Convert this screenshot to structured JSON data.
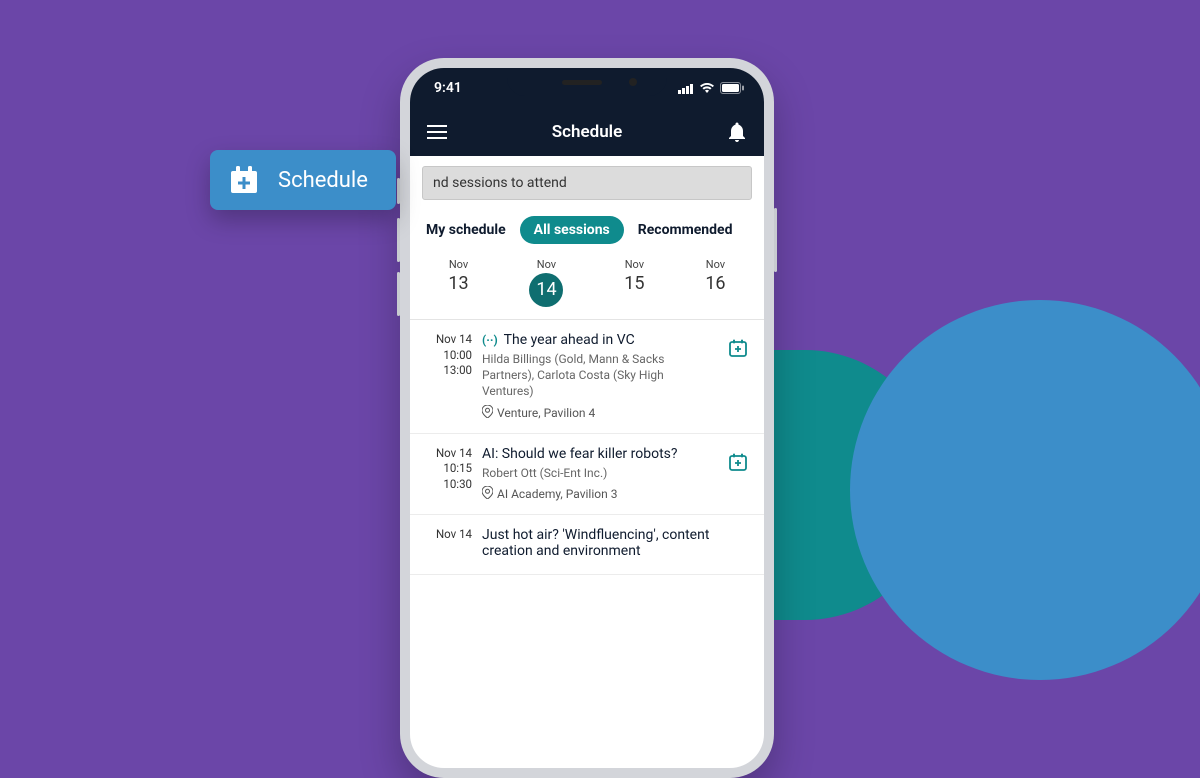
{
  "status": {
    "time": "9:41"
  },
  "header": {
    "title": "Schedule"
  },
  "search": {
    "placeholder": "Find sessions to attend",
    "visible_text": "nd sessions to attend"
  },
  "tabs": {
    "my": "My schedule",
    "all": "All sessions",
    "rec": "Recommended"
  },
  "dates": [
    {
      "month": "Nov",
      "day": "13",
      "active": false
    },
    {
      "month": "Nov",
      "day": "14",
      "active": true
    },
    {
      "month": "Nov",
      "day": "15",
      "active": false
    },
    {
      "month": "Nov",
      "day": "16",
      "active": false
    }
  ],
  "sessions": [
    {
      "date": "Nov 14",
      "start": "10:00",
      "end": "13:00",
      "live_badge": "(··)",
      "title": "The year ahead in VC",
      "speakers": "Hilda Billings (Gold, Mann & Sacks Partners), Carlota Costa (Sky High Ventures)",
      "location": "Venture, Pavilion 4"
    },
    {
      "date": "Nov 14",
      "start": "10:15",
      "end": "10:30",
      "title": "AI: Should we fear killer robots?",
      "speakers": "Robert Ott (Sci-Ent Inc.)",
      "location": "AI Academy, Pavilion 3"
    },
    {
      "date": "Nov 14",
      "title": "Just hot air? 'Windfluencing', content creation and environment"
    }
  ],
  "chip": {
    "label": "Schedule"
  }
}
